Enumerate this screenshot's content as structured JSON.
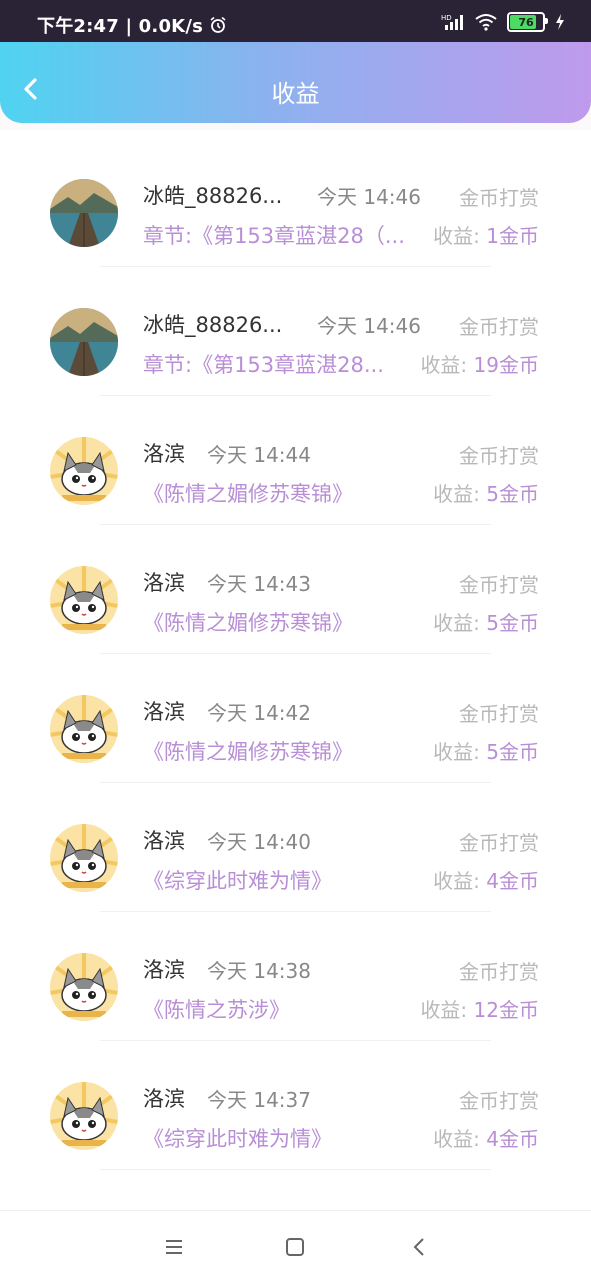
{
  "status": {
    "time_speed": "下午2:47 | 0.0K/s",
    "battery": "76",
    "net_tag": "HD"
  },
  "header": {
    "title": "收益"
  },
  "rows": [
    {
      "name": "冰皓_88826...",
      "time": "今天 14:46",
      "type": "金币打赏",
      "book": "章节:《第153章蓝湛28（...",
      "earn_label": "收益:",
      "earn_value": "1金币",
      "avatar": "landscape"
    },
    {
      "name": "冰皓_88826...",
      "time": "今天 14:46",
      "type": "金币打赏",
      "book": "章节:《第153章蓝湛28...",
      "earn_label": "收益:",
      "earn_value": "19金币",
      "avatar": "landscape"
    },
    {
      "name": "洛滨",
      "time": "今天 14:44",
      "type": "金币打赏",
      "book": "《陈情之媚修苏寒锦》",
      "earn_label": "收益:",
      "earn_value": "5金币",
      "avatar": "cat"
    },
    {
      "name": "洛滨",
      "time": "今天 14:43",
      "type": "金币打赏",
      "book": "《陈情之媚修苏寒锦》",
      "earn_label": "收益:",
      "earn_value": "5金币",
      "avatar": "cat"
    },
    {
      "name": "洛滨",
      "time": "今天 14:42",
      "type": "金币打赏",
      "book": "《陈情之媚修苏寒锦》",
      "earn_label": "收益:",
      "earn_value": "5金币",
      "avatar": "cat"
    },
    {
      "name": "洛滨",
      "time": "今天 14:40",
      "type": "金币打赏",
      "book": "《综穿此时难为情》",
      "earn_label": "收益:",
      "earn_value": "4金币",
      "avatar": "cat"
    },
    {
      "name": "洛滨",
      "time": "今天 14:38",
      "type": "金币打赏",
      "book": "《陈情之苏涉》",
      "earn_label": "收益:",
      "earn_value": "12金币",
      "avatar": "cat"
    },
    {
      "name": "洛滨",
      "time": "今天 14:37",
      "type": "金币打赏",
      "book": "《综穿此时难为情》",
      "earn_label": "收益:",
      "earn_value": "4金币",
      "avatar": "cat"
    }
  ],
  "nav": {
    "menu_icon": "menu-icon",
    "home_icon": "home-icon",
    "back_icon": "back-icon"
  }
}
